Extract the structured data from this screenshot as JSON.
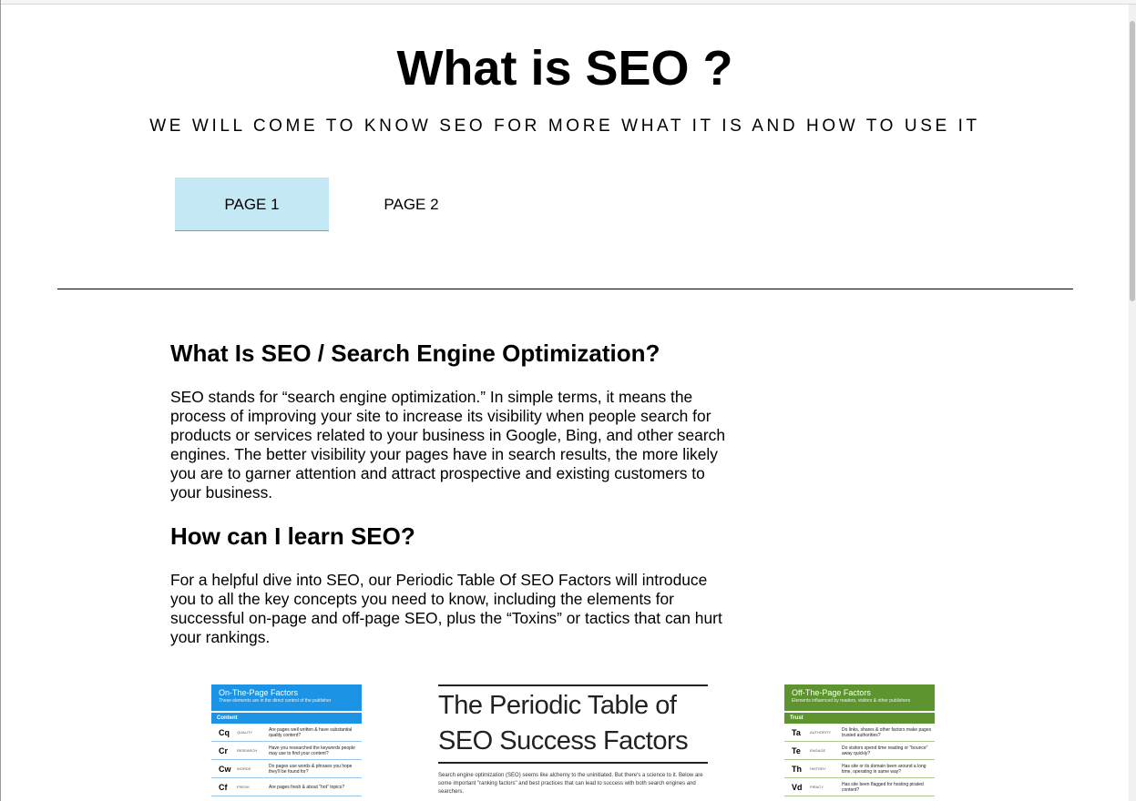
{
  "header": {
    "title": "What is SEO ?",
    "tagline": "WE WILL COME TO KNOW SEO FOR MORE WHAT IT IS AND HOW TO USE IT"
  },
  "nav": {
    "page1": "PAGE 1",
    "page2": "PAGE 2",
    "active_color": "#c5e8f5"
  },
  "article": {
    "section1_heading": "What Is SEO / Search Engine Optimization?",
    "section1_body": "SEO stands for “search engine optimization.” In simple terms, it means the process of improving your site to increase its visibility when people search for products or services related to your business in Google, Bing, and other search engines. The better visibility your pages have in search results, the more likely you are to garner attention and attract prospective and existing customers to your business.",
    "section2_heading": "How can I learn SEO?",
    "section2_body": "For a helpful dive into SEO, our Periodic Table Of SEO Factors will introduce you to all the key concepts you need to know, including the elements for successful on-page and off-page SEO, plus the “Toxins” or tactics that can hurt your rankings."
  },
  "infographic": {
    "left": {
      "title": "On-The-Page Factors",
      "subtitle": "These elements are in the direct control of the publisher",
      "section": "Content",
      "color": "#1d93e5",
      "rows": [
        {
          "sym": "Cq",
          "cat": "QUALITY",
          "q": "Are pages well written & have substantial quality content?"
        },
        {
          "sym": "Cr",
          "cat": "RESEARCH",
          "q": "Have you researched the keywords people may use to find your content?"
        },
        {
          "sym": "Cw",
          "cat": "WORDS",
          "q": "Do pages use words & phrases you hope they'll be found for?"
        },
        {
          "sym": "Cf",
          "cat": "FRESH",
          "q": "Are pages fresh & about \"hot\" topics?"
        }
      ]
    },
    "center": {
      "title": "The Periodic Table of SEO Success Factors",
      "body": "Search engine optimization (SEO) seems like alchemy to the uninitiated. But there's a science to it. Below are some important \"ranking factors\" and best practices that can lead to success with both search engines and searchers."
    },
    "right": {
      "title": "Off-The-Page Factors",
      "subtitle": "Elements influenced by readers, visitors & other publishers",
      "section": "Trust",
      "color": "#5d9430",
      "rows": [
        {
          "sym": "Ta",
          "cat": "AUTHORITY",
          "q": "Do links, shares & other factors make pages trusted authorities?"
        },
        {
          "sym": "Te",
          "cat": "ENGAGE",
          "q": "Do visitors spend time reading or \"bounce\" away quickly?"
        },
        {
          "sym": "Th",
          "cat": "HISTORY",
          "q": "Has site or its domain been around a long time, operating in same way?"
        },
        {
          "sym": "Vd",
          "cat": "PIRACY",
          "q": "Has site been flagged for hosting pirated content?"
        }
      ]
    }
  }
}
